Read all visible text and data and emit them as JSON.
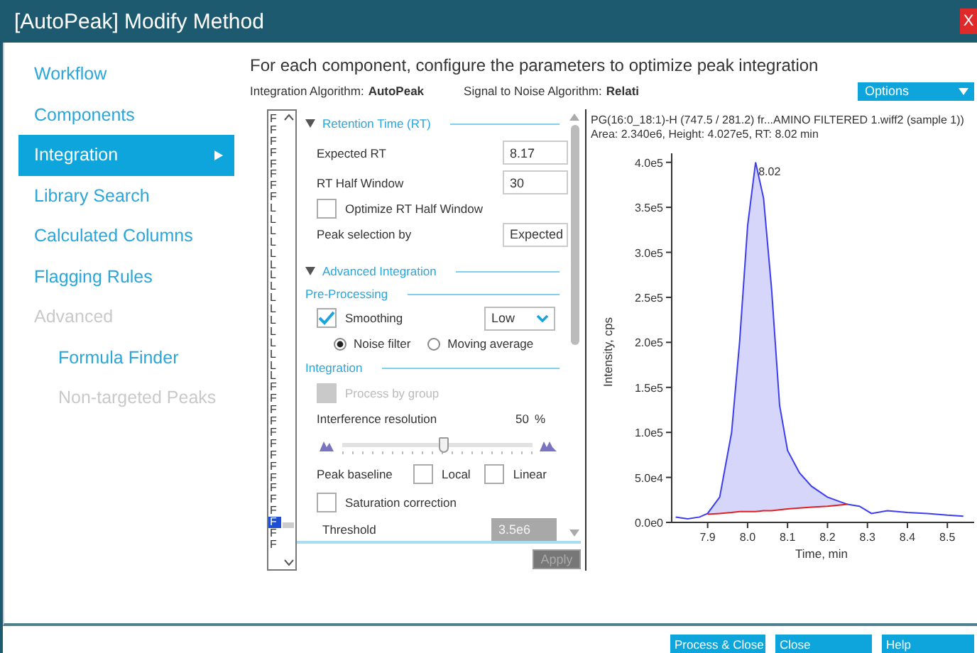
{
  "window": {
    "title": "[AutoPeak] Modify Method",
    "close_label": "X"
  },
  "sidebar": {
    "items": [
      {
        "label": "Workflow",
        "selected": false,
        "disabled": false
      },
      {
        "label": "Components",
        "selected": false,
        "disabled": false
      },
      {
        "label": "Integration",
        "selected": true,
        "disabled": false
      },
      {
        "label": "Library Search",
        "selected": false,
        "disabled": false
      },
      {
        "label": "Calculated Columns",
        "selected": false,
        "disabled": false
      },
      {
        "label": "Flagging Rules",
        "selected": false,
        "disabled": false
      },
      {
        "label": "Advanced",
        "selected": false,
        "disabled": true,
        "children": [
          {
            "label": "Formula Finder",
            "selected": false,
            "disabled": false
          },
          {
            "label": "Non-targeted Peaks",
            "selected": false,
            "disabled": true
          }
        ]
      }
    ]
  },
  "heading": "For each component, configure the parameters to optimize peak integration",
  "info": [
    {
      "label": "Integration Algorithm:",
      "value": "AutoPeak"
    },
    {
      "label": "Signal to Noise Algorithm:",
      "value": "Relati"
    }
  ],
  "options_button": "Options",
  "components": {
    "items": [
      {
        "label": "F",
        "selected": false
      },
      {
        "label": "F",
        "selected": false
      },
      {
        "label": "F",
        "selected": false
      },
      {
        "label": "F",
        "selected": false
      },
      {
        "label": "F",
        "selected": false
      },
      {
        "label": "F",
        "selected": false
      },
      {
        "label": "F",
        "selected": false
      },
      {
        "label": "F",
        "selected": false
      },
      {
        "label": "L",
        "selected": false
      },
      {
        "label": "L",
        "selected": false
      },
      {
        "label": "L",
        "selected": false
      },
      {
        "label": "L",
        "selected": false
      },
      {
        "label": "L",
        "selected": false
      },
      {
        "label": "L",
        "selected": false
      },
      {
        "label": "L",
        "selected": false
      },
      {
        "label": "L",
        "selected": false
      },
      {
        "label": "L",
        "selected": false
      },
      {
        "label": "L",
        "selected": false
      },
      {
        "label": "L",
        "selected": false
      },
      {
        "label": "L",
        "selected": false
      },
      {
        "label": "L",
        "selected": false
      },
      {
        "label": "L",
        "selected": false
      },
      {
        "label": "L",
        "selected": false
      },
      {
        "label": "L",
        "selected": false
      },
      {
        "label": "F",
        "selected": false
      },
      {
        "label": "F",
        "selected": false
      },
      {
        "label": "F",
        "selected": false
      },
      {
        "label": "F",
        "selected": false
      },
      {
        "label": "F",
        "selected": false
      },
      {
        "label": "F",
        "selected": false
      },
      {
        "label": "F",
        "selected": false
      },
      {
        "label": "F",
        "selected": false
      },
      {
        "label": "F",
        "selected": false
      },
      {
        "label": "F",
        "selected": false
      },
      {
        "label": "F",
        "selected": false
      },
      {
        "label": "F",
        "selected": false
      },
      {
        "label": "F",
        "selected": true
      },
      {
        "label": "F",
        "selected": false
      },
      {
        "label": "F",
        "selected": false
      }
    ]
  },
  "form": [
    {
      "kind": "section",
      "label": "Retention Time (RT)",
      "expanded": true
    },
    {
      "kind": "input",
      "label": "Expected RT",
      "value": "8.17",
      "disabled": false
    },
    {
      "kind": "input",
      "label": "RT Half Window",
      "value": "30",
      "disabled": false
    },
    {
      "kind": "checkbox",
      "label": "Optimize RT Half Window",
      "checked": false,
      "disabled": false
    },
    {
      "kind": "input",
      "label": "Peak selection by",
      "value": "Expected",
      "disabled": false
    },
    {
      "kind": "section",
      "label": "Advanced Integration",
      "expanded": true
    },
    {
      "kind": "subsection",
      "label": "Pre-Processing"
    },
    {
      "kind": "checkbox_select",
      "label": "Smoothing",
      "checked": true,
      "value": "Low"
    },
    {
      "kind": "radios",
      "options": [
        {
          "label": "Noise filter",
          "selected": true
        },
        {
          "label": "Moving average",
          "selected": false
        }
      ]
    },
    {
      "kind": "subsection",
      "label": "Integration"
    },
    {
      "kind": "checkbox",
      "label": "Process by group",
      "checked": false,
      "disabled": true
    },
    {
      "kind": "reading",
      "label": "Interference resolution",
      "value": "50",
      "unit": "%"
    },
    {
      "kind": "slider",
      "level": 0.53
    },
    {
      "kind": "checks",
      "label": "Peak baseline",
      "options": [
        {
          "label": "Local",
          "checked": false
        },
        {
          "label": "Linear",
          "checked": false
        }
      ]
    },
    {
      "kind": "checkbox",
      "label": "Saturation correction",
      "checked": false,
      "disabled": false
    },
    {
      "kind": "sub_input",
      "label": "Threshold",
      "value": "3.5e6",
      "disabled": true
    }
  ],
  "apply_button": {
    "label": "Apply",
    "disabled": true
  },
  "chart": {
    "title": "PG(16:0_18:1)-H (747.5 / 281.2) fr...AMINO FILTERED 1.wiff2 (sample 1))",
    "summary": "Area: 2.340e6, Height: 4.027e5, RT: 8.02 min",
    "chart_data": {
      "type": "line",
      "xlabel": "Time, min",
      "ylabel": "Intensity, cps",
      "x": [
        7.82,
        7.85,
        7.88,
        7.9,
        7.93,
        7.96,
        7.98,
        8.0,
        8.02,
        8.04,
        8.06,
        8.08,
        8.1,
        8.13,
        8.16,
        8.2,
        8.25,
        8.28,
        8.31,
        8.35,
        8.4,
        8.45,
        8.5,
        8.54
      ],
      "series": [
        {
          "color": "#3c3cf0",
          "values": [
            6000,
            4000,
            6000,
            10000,
            28000,
            100000,
            200000,
            330000,
            400000,
            360000,
            260000,
            130000,
            80000,
            55000,
            40000,
            28000,
            20000,
            18000,
            10000,
            13000,
            11000,
            10000,
            8000,
            7000
          ]
        },
        {
          "color": "#e02020",
          "values": [
            null,
            null,
            null,
            9000,
            10000,
            11000,
            12000,
            12000,
            12000,
            13000,
            13000,
            14000,
            15000,
            16000,
            17000,
            18000,
            20000,
            null,
            null,
            null,
            null,
            null,
            null,
            null
          ]
        }
      ],
      "xlim": [
        7.81,
        8.56
      ],
      "ylim": [
        0,
        410000
      ],
      "xticks": [
        7.9,
        {
          "value": 8,
          "label": "8.0"
        },
        8.1,
        8.2,
        8.3,
        8.4,
        8.5
      ],
      "yticks": [
        {
          "value": 0,
          "label": "0.0e0"
        },
        {
          "value": 50000,
          "label": "5.0e4"
        },
        {
          "value": 100000,
          "label": "1.0e5"
        },
        {
          "value": 150000,
          "label": "1.5e5"
        },
        {
          "value": 200000,
          "label": "2.0e5"
        },
        {
          "value": 250000,
          "label": "2.5e5"
        },
        {
          "value": 300000,
          "label": "3.0e5"
        },
        {
          "value": 350000,
          "label": "3.5e5"
        },
        {
          "value": 400000,
          "label": "4.0e5"
        }
      ],
      "annotations": [
        {
          "x": 8.02,
          "y": 400000,
          "text": "8.02"
        }
      ]
    }
  },
  "footer_buttons": [
    "Process & Close",
    "Close",
    "Help"
  ]
}
